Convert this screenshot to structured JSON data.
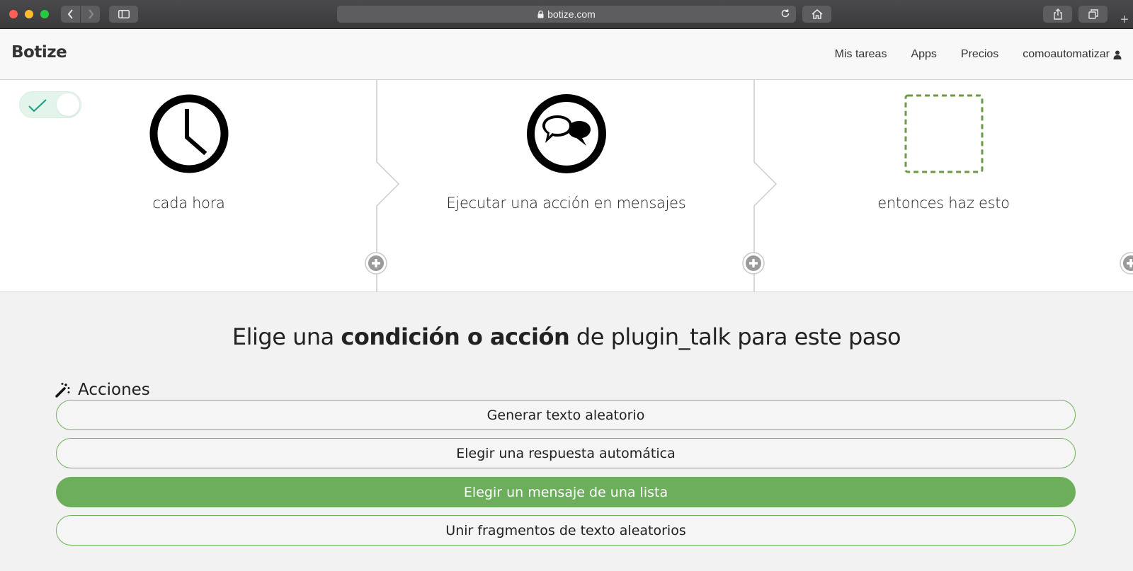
{
  "browser": {
    "url": "botize.com",
    "icons": [
      "back-icon",
      "forward-icon",
      "sidebar-icon",
      "lock-icon",
      "reload-icon",
      "home-icon",
      "share-icon",
      "tabs-icon",
      "plus-icon"
    ]
  },
  "navbar": {
    "brand": "Botize",
    "links": [
      "Mis tareas",
      "Apps",
      "Precios"
    ],
    "user": "comoautomatizar"
  },
  "toggle": {
    "state": "on",
    "color": "#1a9a8a"
  },
  "steps": [
    {
      "icon": "clock-icon",
      "label": "cada hora"
    },
    {
      "icon": "chat-bubbles-icon",
      "label": "Ejecutar una acción en mensajes"
    },
    {
      "icon": "empty-slot",
      "label": "entonces haz esto"
    }
  ],
  "chooser": {
    "title_pre": "Elige una ",
    "title_bold": "condición o acción",
    "title_post": " de plugin_talk para este paso",
    "section": "Acciones",
    "options": [
      {
        "label": "Generar texto aleatorio",
        "selected": false
      },
      {
        "label": "Elegir una respuesta automática",
        "selected": false
      },
      {
        "label": "Elegir un mensaje de una lista",
        "selected": true
      },
      {
        "label": "Unir fragmentos de texto aleatorios",
        "selected": false
      }
    ]
  },
  "colors": {
    "accent": "#6cae5b",
    "dashed": "#6a9a45"
  }
}
